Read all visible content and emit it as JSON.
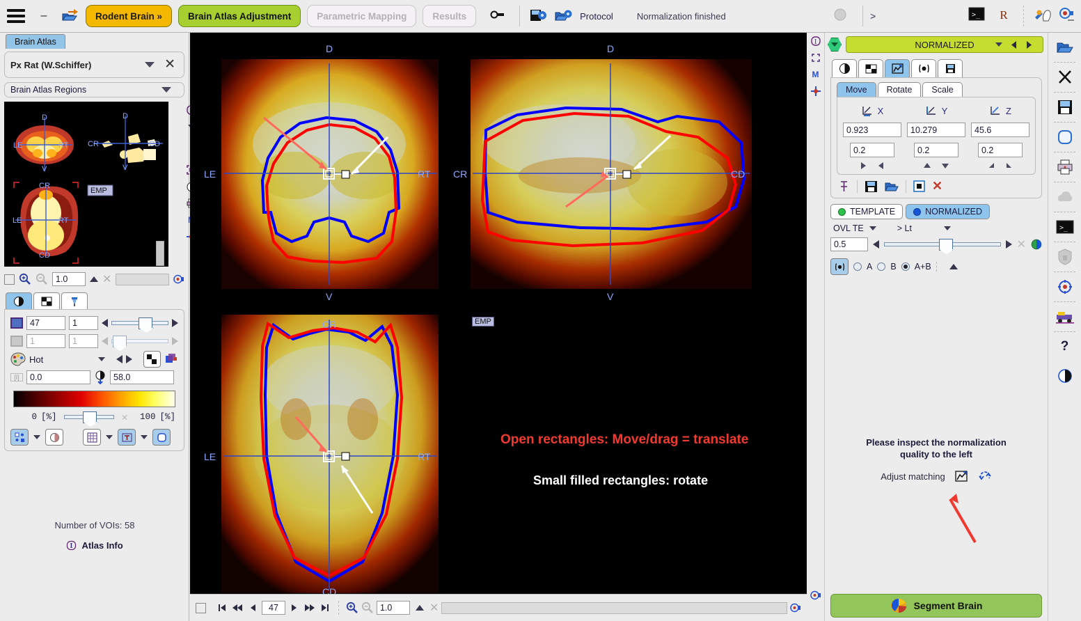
{
  "topbar": {
    "menu_icon": "hamburger-icon",
    "minimize_icon": "minimize-icon",
    "open_icon": "open-folder-icon",
    "steps": [
      {
        "label": "Rodent Brain »",
        "state": "active-orange"
      },
      {
        "label": "Brain Atlas Adjustment",
        "state": "active-green"
      },
      {
        "label": "Parametric Mapping",
        "state": "disabled"
      },
      {
        "label": "Results",
        "state": "disabled"
      }
    ],
    "link_icon": "link-icon",
    "save_protocol_icon": "save-protocol-icon",
    "load_protocol_icon": "load-protocol-icon",
    "protocol_label": "Protocol",
    "status": "Normalization finished",
    "prompt_symbol": ">",
    "terminal_icon": "terminal-icon",
    "r_icon": "R",
    "tools_icon": "tools-icon",
    "capture_icon": "capture-icon"
  },
  "left": {
    "tab_label": "Brain Atlas",
    "atlas_name": "Px Rat (W.Schiffer)",
    "regions_label": "Brain Atlas Regions",
    "thumb_labels": {
      "coronal": {
        "d": "D",
        "v": "V",
        "le": "LE",
        "rt": "RT"
      },
      "sagittal": {
        "d": "D",
        "v": "V",
        "cr": "CR",
        "cd": "CD"
      },
      "axial": {
        "cr": "CR",
        "cd": "CD",
        "le": "LE",
        "rt": "RT"
      },
      "emp": "EMP"
    },
    "zoom_value": "1.0",
    "slice_index": "47",
    "slice_max": "1",
    "frame_index": "1",
    "frame_max": "1",
    "colormap": "Hot",
    "lower_threshold": "0.0",
    "upper_threshold": "58.0",
    "pct_min": "0",
    "pct_min_unit": "[%]",
    "pct_max": "100",
    "pct_max_unit": "[%]",
    "voi_count_label": "Number of VOIs: 58",
    "atlas_info_label": "Atlas Info"
  },
  "center": {
    "coronal": {
      "d": "D",
      "v": "V",
      "le": "LE",
      "rt": "RT"
    },
    "sagittal": {
      "d": "D",
      "v": "V",
      "cr": "CR",
      "cd": "CD"
    },
    "axial": {
      "cr": "CR",
      "cd": "CD",
      "le": "LE",
      "rt": "RT"
    },
    "emp_badge": "EMP",
    "annotation_red": "Open rectangles: Move/drag = translate",
    "annotation_white": "Small filled rectangles: rotate",
    "contour_colors": {
      "template": "#0000ff",
      "normalized": "#ff0000"
    },
    "nav": {
      "slice": "47",
      "zoom": "1.0",
      "first_icon": "first-slice-icon",
      "prev_fast_icon": "prev-fast-icon",
      "prev_icon": "prev-slice-icon",
      "next_icon": "next-slice-icon",
      "next_fast_icon": "next-fast-icon",
      "last_icon": "last-slice-icon",
      "zoom_in_icon": "zoom-in-icon",
      "zoom_out_icon": "zoom-out-icon"
    }
  },
  "right": {
    "header_title": "NORMALIZED",
    "tabs": [
      {
        "name": "contrast-tab",
        "on": false
      },
      {
        "name": "layout-tab",
        "on": false
      },
      {
        "name": "matching-tab",
        "on": true
      },
      {
        "name": "fusion-tab",
        "on": false
      },
      {
        "name": "save-tab",
        "on": false
      }
    ],
    "transform_tabs": [
      {
        "label": "Move",
        "on": true
      },
      {
        "label": "Rotate",
        "on": false
      },
      {
        "label": "Scale",
        "on": false
      }
    ],
    "axes": [
      {
        "label": "X",
        "value": "0.923",
        "step": "0.2"
      },
      {
        "label": "Y",
        "value": "10.279",
        "step": "0.2"
      },
      {
        "label": "Z",
        "value": "45.6",
        "step": "0.2"
      }
    ],
    "action_icons": [
      "pin-icon",
      "save-icon",
      "open-icon",
      "reset-icon",
      "delete-icon"
    ],
    "series_tabs": [
      {
        "label": "TEMPLATE",
        "on": false,
        "color": "#31c24d"
      },
      {
        "label": "NORMALIZED",
        "on": true,
        "color": "#1756d6"
      }
    ],
    "ovl_label": "OVL TE",
    "lt_label": "> Lt",
    "blend_value": "0.5",
    "view_modes": [
      {
        "label": "A",
        "on": false
      },
      {
        "label": "B",
        "on": false
      },
      {
        "label": "A+B",
        "on": true
      }
    ],
    "guide_line1": "Please inspect the normalization",
    "guide_line2": "quality to the left",
    "adjust_label": "Adjust matching",
    "adjust_icon": "matching-icon",
    "refresh_icon": "refresh-icon",
    "segment_button": "Segment Brain"
  },
  "far_rail": {
    "icons": [
      "open-folder-icon",
      "scissors-icon",
      "save-icon",
      "shape-icon",
      "printer-icon",
      "cloud-icon",
      "terminal-icon",
      "shield-icon",
      "target-icon",
      "truck-icon",
      "help-icon",
      "contrast-icon"
    ],
    "help_glyph": "?"
  }
}
